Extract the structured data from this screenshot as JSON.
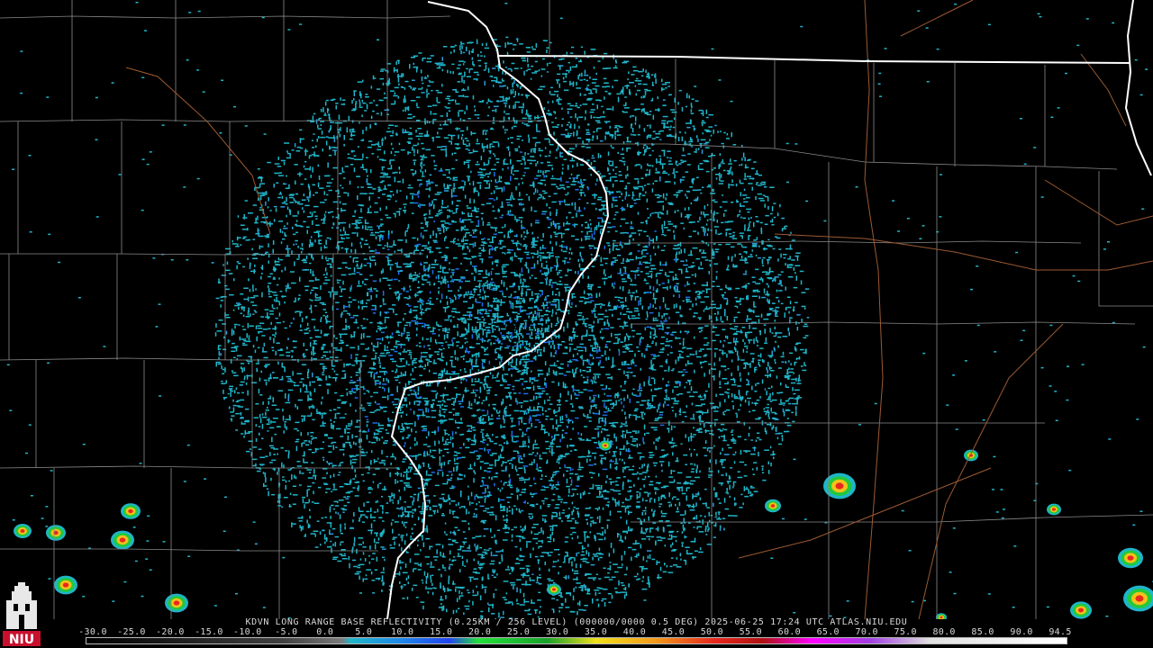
{
  "radar": {
    "station": "KDVN",
    "caption": "KDVN LONG RANGE BASE REFLECTIVITY (0.25KM / 256 LEVEL) (000000/0000 0.5 DEG) 2025-06-25 17:24 UTC   ATLAS.NIU.EDU",
    "product": "Long range base reflectivity",
    "tilt_deg": 0.5,
    "timestamp": "2025-06-25 17:24 UTC",
    "source": "ATLAS.NIU.EDU"
  },
  "scale": {
    "ticks": [
      "-30.0",
      "-25.0",
      "-20.0",
      "-15.0",
      "-10.0",
      "-5.0",
      "0.0",
      "5.0",
      "10.0",
      "15.0",
      "20.0",
      "25.0",
      "30.0",
      "35.0",
      "40.0",
      "45.0",
      "50.0",
      "55.0",
      "60.0",
      "65.0",
      "70.0",
      "75.0",
      "80.0",
      "85.0",
      "90.0",
      "94.5"
    ],
    "colors": {
      "background": "#000000",
      "clear_air": "#1fb5c9",
      "light": "#1e6ee8",
      "moderate": "#22c93a",
      "heavy": "#f2c21a",
      "intense": "#e8281e",
      "state_border": "#ffffff",
      "county_border": "#8a8a8a",
      "highway": "#9c5a32"
    }
  },
  "logo": {
    "name": "NIU",
    "text": "NIU",
    "color": "#c8102e"
  }
}
